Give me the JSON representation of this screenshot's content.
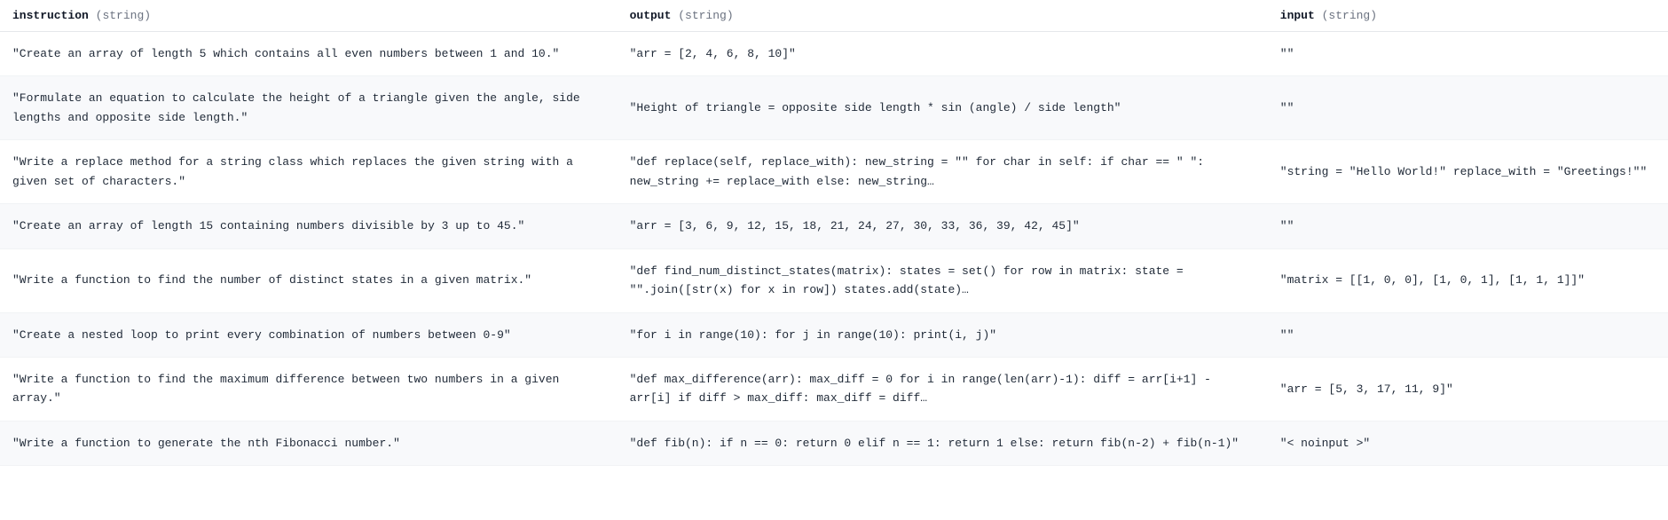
{
  "columns": [
    {
      "name": "instruction",
      "type": "string"
    },
    {
      "name": "output",
      "type": "string"
    },
    {
      "name": "input",
      "type": "string"
    }
  ],
  "rows": [
    {
      "instruction": "\"Create an array of length 5 which contains all even numbers between 1 and 10.\"",
      "output": "\"arr = [2, 4, 6, 8, 10]\"",
      "input": "\"\""
    },
    {
      "instruction": "\"Formulate an equation to calculate the height of a triangle given the angle, side lengths and opposite side length.\"",
      "output": "\"Height of triangle = opposite side length * sin (angle) / side length\"",
      "input": "\"\""
    },
    {
      "instruction": "\"Write a replace method for a string class which replaces the given string with a given set of characters.\"",
      "output": "\"def replace(self, replace_with): new_string = \"\" for char in self: if char == \" \": new_string += replace_with else: new_string…",
      "input": "\"string = \"Hello World!\" replace_with = \"Greetings!\"\""
    },
    {
      "instruction": "\"Create an array of length 15 containing numbers divisible by 3 up to 45.\"",
      "output": "\"arr = [3, 6, 9, 12, 15, 18, 21, 24, 27, 30, 33, 36, 39, 42, 45]\"",
      "input": "\"\""
    },
    {
      "instruction": "\"Write a function to find the number of distinct states in a given matrix.\"",
      "output": "\"def find_num_distinct_states(matrix): states = set() for row in matrix: state = \"\".join([str(x) for x in row]) states.add(state)…",
      "input": "\"matrix = [[1, 0, 0], [1, 0, 1], [1, 1, 1]]\""
    },
    {
      "instruction": "\"Create a nested loop to print every combination of numbers between 0-9\"",
      "output": "\"for i in range(10): for j in range(10): print(i, j)\"",
      "input": "\"\""
    },
    {
      "instruction": "\"Write a function to find the maximum difference between two numbers in a given array.\"",
      "output": "\"def max_difference(arr): max_diff = 0 for i in range(len(arr)-1): diff = arr[i+1] - arr[i] if diff > max_diff: max_diff = diff…",
      "input": "\"arr = [5, 3, 17, 11, 9]\""
    },
    {
      "instruction": "\"Write a function to generate the nth Fibonacci number.\"",
      "output": "\"def fib(n): if n == 0: return 0 elif n == 1: return 1 else: return fib(n-2) + fib(n-1)\"",
      "input": "\"< noinput >\""
    }
  ]
}
